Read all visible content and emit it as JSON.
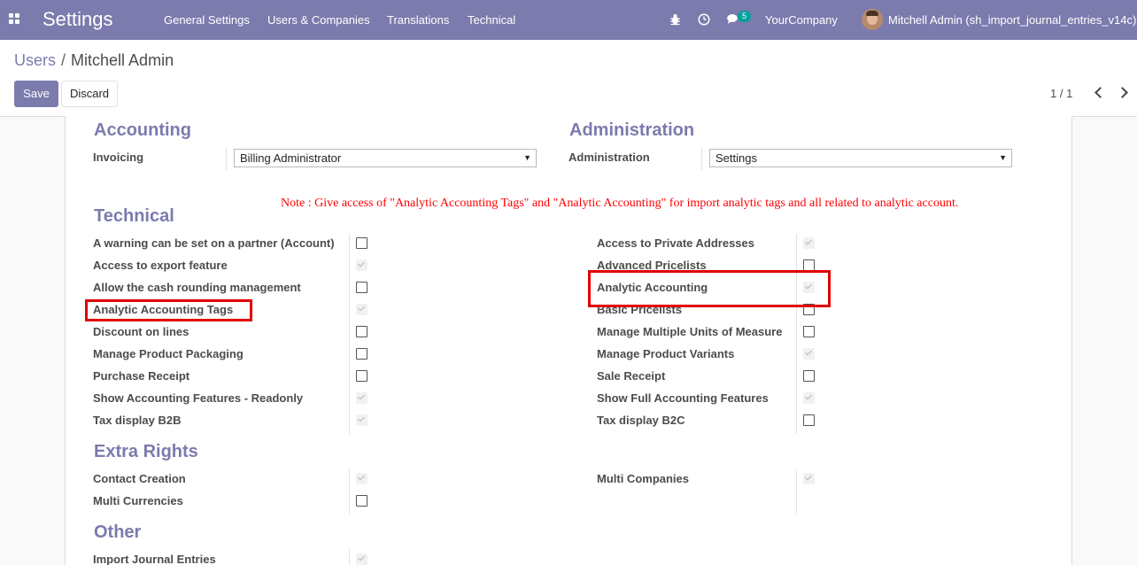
{
  "navbar": {
    "brand": "Settings",
    "menu": [
      "General Settings",
      "Users & Companies",
      "Translations",
      "Technical"
    ],
    "message_count": "5",
    "company": "YourCompany",
    "user": "Mitchell Admin (sh_import_journal_entries_v14c)"
  },
  "breadcrumb": {
    "parent": "Users",
    "separator": "/",
    "current": "Mitchell Admin"
  },
  "buttons": {
    "save": "Save",
    "discard": "Discard"
  },
  "pager": {
    "value": "1 / 1"
  },
  "sections": {
    "accounting": "Accounting",
    "administration": "Administration",
    "technical": "Technical",
    "extra_rights": "Extra Rights",
    "other": "Other"
  },
  "accounting": {
    "label": "Invoicing",
    "value": "Billing Administrator"
  },
  "administration": {
    "label": "Administration",
    "value": "Settings"
  },
  "note": "Note : Give access of \"Analytic Accounting Tags\" and \"Analytic Accounting\" for import analytic tags and all related to analytic account.",
  "technical_left": [
    {
      "label": "A warning can be set on a partner (Account)",
      "checked": false
    },
    {
      "label": "Access to export feature",
      "checked": true
    },
    {
      "label": "Allow the cash rounding management",
      "checked": false
    },
    {
      "label": "Analytic Accounting Tags",
      "checked": true
    },
    {
      "label": "Discount on lines",
      "checked": false
    },
    {
      "label": "Manage Product Packaging",
      "checked": false
    },
    {
      "label": "Purchase Receipt",
      "checked": false
    },
    {
      "label": "Show Accounting Features - Readonly",
      "checked": true
    },
    {
      "label": "Tax display B2B",
      "checked": true
    }
  ],
  "technical_right": [
    {
      "label": "Access to Private Addresses",
      "checked": true
    },
    {
      "label": "Advanced Pricelists",
      "checked": false
    },
    {
      "label": "Analytic Accounting",
      "checked": true
    },
    {
      "label": "Basic Pricelists",
      "checked": false
    },
    {
      "label": "Manage Multiple Units of Measure",
      "checked": false
    },
    {
      "label": "Manage Product Variants",
      "checked": true
    },
    {
      "label": "Sale Receipt",
      "checked": false
    },
    {
      "label": "Show Full Accounting Features",
      "checked": true
    },
    {
      "label": "Tax display B2C",
      "checked": false
    }
  ],
  "extra_left": [
    {
      "label": "Contact Creation",
      "checked": true
    },
    {
      "label": "Multi Currencies",
      "checked": false
    }
  ],
  "extra_right": [
    {
      "label": "Multi Companies",
      "checked": true
    }
  ],
  "other_left": [
    {
      "label": "Import Journal Entries",
      "checked": true
    }
  ]
}
